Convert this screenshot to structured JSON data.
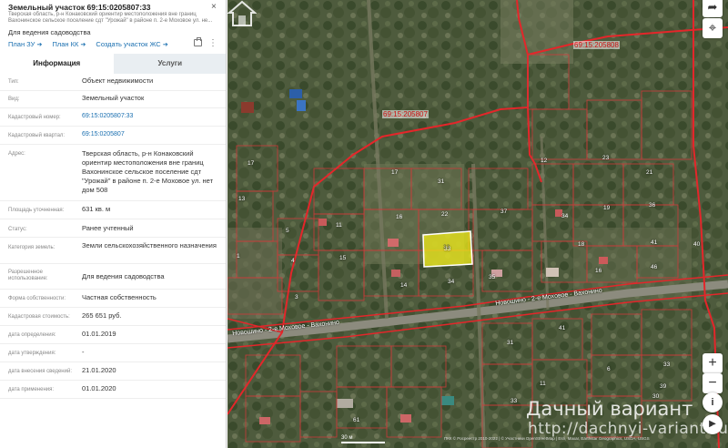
{
  "panel": {
    "title": "Земельный участок 69:15:0205807:33",
    "subtitle": "Тверская область, р-н Конаковский ориентир местоположения вне границ Вахонинское сельское поселение сдт \"Урожай\" в районе п. 2-е Моховое ул. не...",
    "purpose": "Для ведения садоводства",
    "links": [
      "План ЗУ",
      "План КК",
      "Создать участок ЖС"
    ],
    "link_arrow": "➔",
    "more": "⋮",
    "close": "×",
    "tabs": [
      "Информация",
      "Услуги"
    ]
  },
  "fields": [
    {
      "key": "Тип:",
      "value": "Объект недвижимости"
    },
    {
      "key": "Вид:",
      "value": "Земельный участок"
    },
    {
      "key": "Кадастровый номер:",
      "value": "69:15:0205807:33"
    },
    {
      "key": "Кадастровый квартал:",
      "value": "69:15:0205807"
    },
    {
      "key": "Адрес:",
      "value": "Тверская область, р-н Конаковский ориентир местоположения вне границ Вахонинское сельское поселение сдт \"Урожай\" в районе п. 2-е Моховое ул. нет дом 508"
    },
    {
      "key": "Площадь уточненная:",
      "value": "631 кв. м"
    },
    {
      "key": "Статус:",
      "value": "Ранее учтенный"
    },
    {
      "key": "Категория земель:",
      "value": "Земли сельскохозяйственного назначения"
    },
    {
      "key": "Разрешенное использование:",
      "value": "Для ведения садоводства"
    },
    {
      "key": "Форма собственности:",
      "value": "Частная собственность"
    },
    {
      "key": "Кадастровая стоимость:",
      "value": "265 651 руб."
    },
    {
      "key": "дата определения:",
      "value": "01.01.2019"
    },
    {
      "key": "дата утверждения:",
      "value": "-"
    },
    {
      "key": "дата внесения сведений:",
      "value": "21.01.2020"
    },
    {
      "key": "дата применения:",
      "value": "01.01.2020"
    }
  ],
  "map": {
    "block_labels": [
      "69:15:205808",
      "69:15:205807"
    ],
    "road_labels": [
      "Новошино - 2-е Моховое - Вахонино",
      "Новошино - 2-е Моховое - Вахонино"
    ],
    "parcel_numbers": [
      "17",
      "17",
      "31",
      "16",
      "22",
      "37",
      "11",
      "34",
      "15",
      "12",
      "19",
      "18",
      "33",
      "14",
      "34",
      "35",
      "16",
      "4",
      "46",
      "3",
      "31",
      "41",
      "33",
      "61",
      "33",
      "30",
      "1",
      "13",
      "23",
      "21",
      "39",
      "6",
      "11",
      "36",
      "41",
      "40",
      "5"
    ],
    "highlighted_parcel": "33",
    "scale_label": "30 м",
    "attribution": "ПКК © Росреестр 2010-2022 | © Участники OpenStreetMap | Esri, Maxar, Earthstar Geographics, USDA, USGS",
    "watermark_line1": "Дачный вариант",
    "watermark_line2": "http://dachnyi-variant.ru",
    "controls": {
      "share": "➦",
      "locate": "⌖",
      "zoom_in": "+",
      "zoom_out": "−",
      "info": "i",
      "play": "▶"
    }
  }
}
